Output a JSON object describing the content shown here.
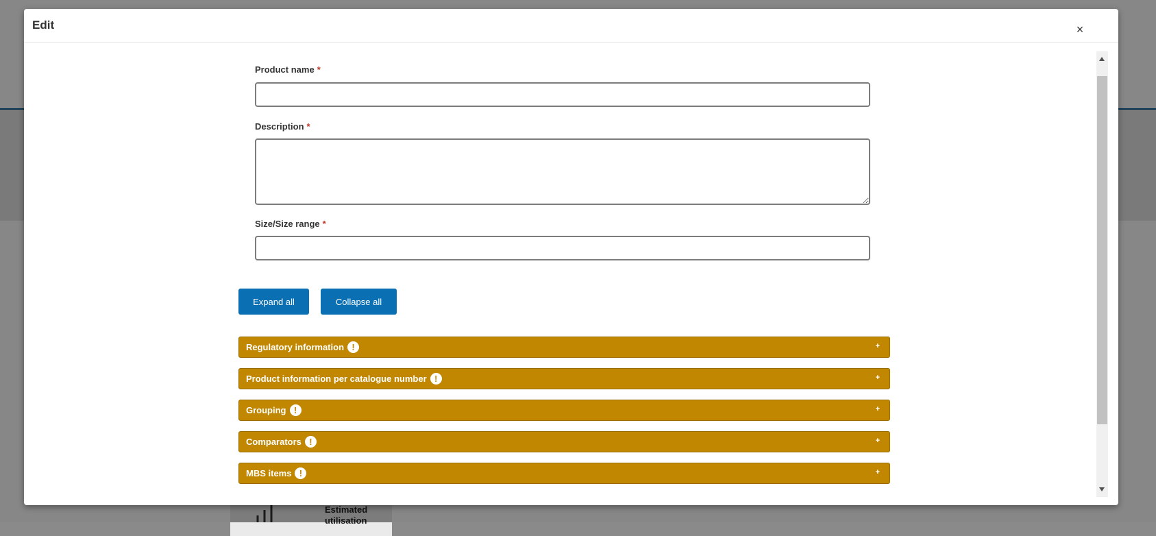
{
  "background": {
    "card_text": "Estimated utilisation"
  },
  "modal": {
    "title": "Edit",
    "close_label": "×"
  },
  "form": {
    "product_name": {
      "label": "Product name",
      "required_mark": "*",
      "value": ""
    },
    "description": {
      "label": "Description",
      "required_mark": "*",
      "value": ""
    },
    "size_range": {
      "label": "Size/Size range",
      "required_mark": "*",
      "value": ""
    }
  },
  "actions": {
    "expand_all": "Expand all",
    "collapse_all": "Collapse all"
  },
  "sections": [
    {
      "title": "Regulatory information",
      "warning": "!",
      "toggle": "+"
    },
    {
      "title": "Product information per catalogue number",
      "warning": "!",
      "toggle": "+"
    },
    {
      "title": "Grouping",
      "warning": "!",
      "toggle": "+"
    },
    {
      "title": "Comparators",
      "warning": "!",
      "toggle": "+"
    },
    {
      "title": "MBS items",
      "warning": "!",
      "toggle": "+"
    }
  ],
  "colors": {
    "accordion": "#c18700",
    "primary_button": "#0a6fb3",
    "required_mark": "#c0392b",
    "header_band": "#0b5e95"
  }
}
